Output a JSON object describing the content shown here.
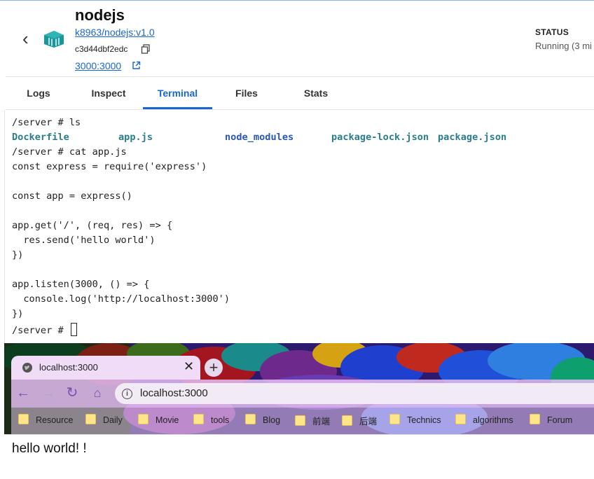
{
  "header": {
    "container_name": "nodejs",
    "image": "k8963/nodejs:v1.0",
    "container_id": "c3d44dbf2edc",
    "port": "3000:3000",
    "status_label": "STATUS",
    "status_value": "Running (3 mi"
  },
  "tabs": [
    {
      "label": "Logs",
      "active": false
    },
    {
      "label": "Inspect",
      "active": false
    },
    {
      "label": "Terminal",
      "active": true
    },
    {
      "label": "Files",
      "active": false
    },
    {
      "label": "Stats",
      "active": false
    }
  ],
  "terminal": {
    "lines": [
      "/server # ls",
      "",
      "/server # cat app.js",
      "const express = require('express')",
      "",
      "const app = express()",
      "",
      "app.get('/', (req, res) => {",
      "  res.send('hello world')",
      "})",
      "",
      "app.listen(3000, () => {",
      "  console.log('http://localhost:3000')",
      "})",
      "/server # "
    ],
    "ls_output": [
      "Dockerfile",
      "app.js",
      "node_modules",
      "package-lock.json",
      "package.json"
    ]
  },
  "browser": {
    "tab_title": "localhost:3000",
    "url": "localhost:3000",
    "bookmarks": [
      "Resource",
      "Daily",
      "Movie",
      "tools",
      "Blog",
      "前端",
      "后端",
      "Technics",
      "algorithms",
      "Forum"
    ],
    "page_text": "hello world! !"
  },
  "icons": {
    "back": "chevron-left-icon",
    "container": "docker-container-icon",
    "copy": "copy-icon",
    "external": "external-link-icon",
    "globe": "globe-icon",
    "close": "close-icon",
    "new_tab": "plus-icon",
    "nav_back": "arrow-left-icon",
    "nav_forward": "arrow-right-icon",
    "reload": "reload-icon",
    "home": "home-icon",
    "info": "info-icon",
    "folder": "folder-icon"
  },
  "colors": {
    "accent": "#1967d2",
    "ls_file": "#2a7e8b",
    "ls_dir": "#2957b8",
    "container_icon": "#18989c"
  }
}
